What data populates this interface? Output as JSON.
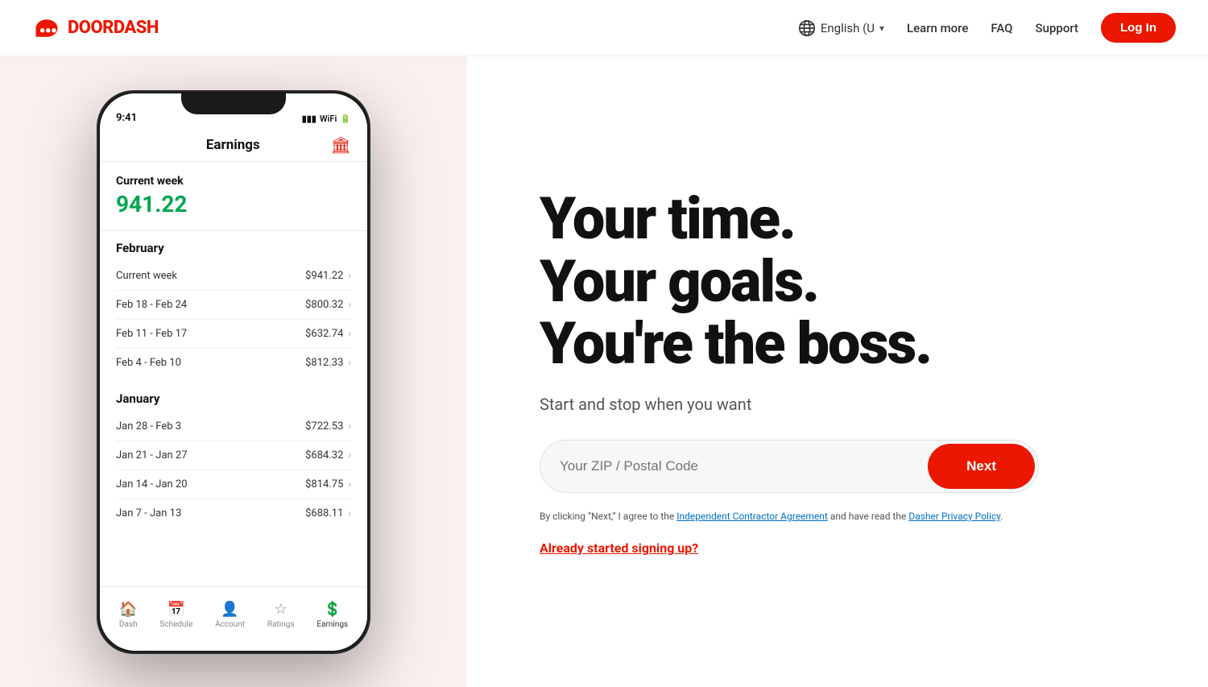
{
  "header": {
    "logo_text": "DOORDASH",
    "lang_label": "English (U",
    "learn_more": "Learn more",
    "faq": "FAQ",
    "support": "Support",
    "login": "Log In"
  },
  "phone": {
    "screen_title": "Earnings",
    "current_week_label": "Current week",
    "current_week_amount": "941.22",
    "sections": [
      {
        "month": "February",
        "rows": [
          {
            "label": "Current week",
            "amount": "$941.22"
          },
          {
            "label": "Feb 18 - Feb 24",
            "amount": "$800.32"
          },
          {
            "label": "Feb 11 - Feb 17",
            "amount": "$632.74"
          },
          {
            "label": "Feb 4 - Feb 10",
            "amount": "$812.33"
          }
        ]
      },
      {
        "month": "January",
        "rows": [
          {
            "label": "Jan 28 - Feb 3",
            "amount": "$722.53"
          },
          {
            "label": "Jan 21 - Jan 27",
            "amount": "$684.32"
          },
          {
            "label": "Jan 14 - Jan 20",
            "amount": "$814.75"
          },
          {
            "label": "Jan 7 - Jan 13",
            "amount": "$688.11"
          }
        ]
      }
    ],
    "bottom_nav": [
      {
        "label": "Dash",
        "active": false
      },
      {
        "label": "Schedule",
        "active": false
      },
      {
        "label": "Account",
        "active": false
      },
      {
        "label": "Ratings",
        "active": false
      },
      {
        "label": "Earnings",
        "active": true
      }
    ]
  },
  "hero": {
    "line1": "Your time.",
    "line2": "Your goals.",
    "line3": "You're the boss.",
    "subtitle": "Start and stop when you want",
    "zip_placeholder": "Your ZIP / Postal Code",
    "next_button": "Next",
    "legal_text": "By clicking “Next,” I agree to the ",
    "legal_link1": "Independent Contractor Agreement",
    "legal_text2": " and have read the ",
    "legal_link2": "Dasher Privacy Policy",
    "legal_text3": ".",
    "already_link": "Already started signing up?"
  }
}
